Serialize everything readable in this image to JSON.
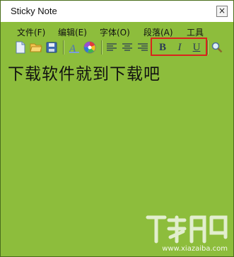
{
  "window": {
    "title": "Sticky Note",
    "close_label": "×"
  },
  "menu": [
    {
      "label": "文件(F)"
    },
    {
      "label": "编辑(E)"
    },
    {
      "label": "字体(O)"
    },
    {
      "label": "段落(A)"
    },
    {
      "label": "工具"
    }
  ],
  "toolbar": {
    "bold_label": "B",
    "italic_label": "I",
    "underline_label": "U"
  },
  "note": {
    "text": "下载软件就到下载吧"
  },
  "watermark": {
    "url": "www.xiazaiba.com"
  },
  "colors": {
    "note_bg": "#8dbd3c",
    "highlight": "#d9241c"
  }
}
